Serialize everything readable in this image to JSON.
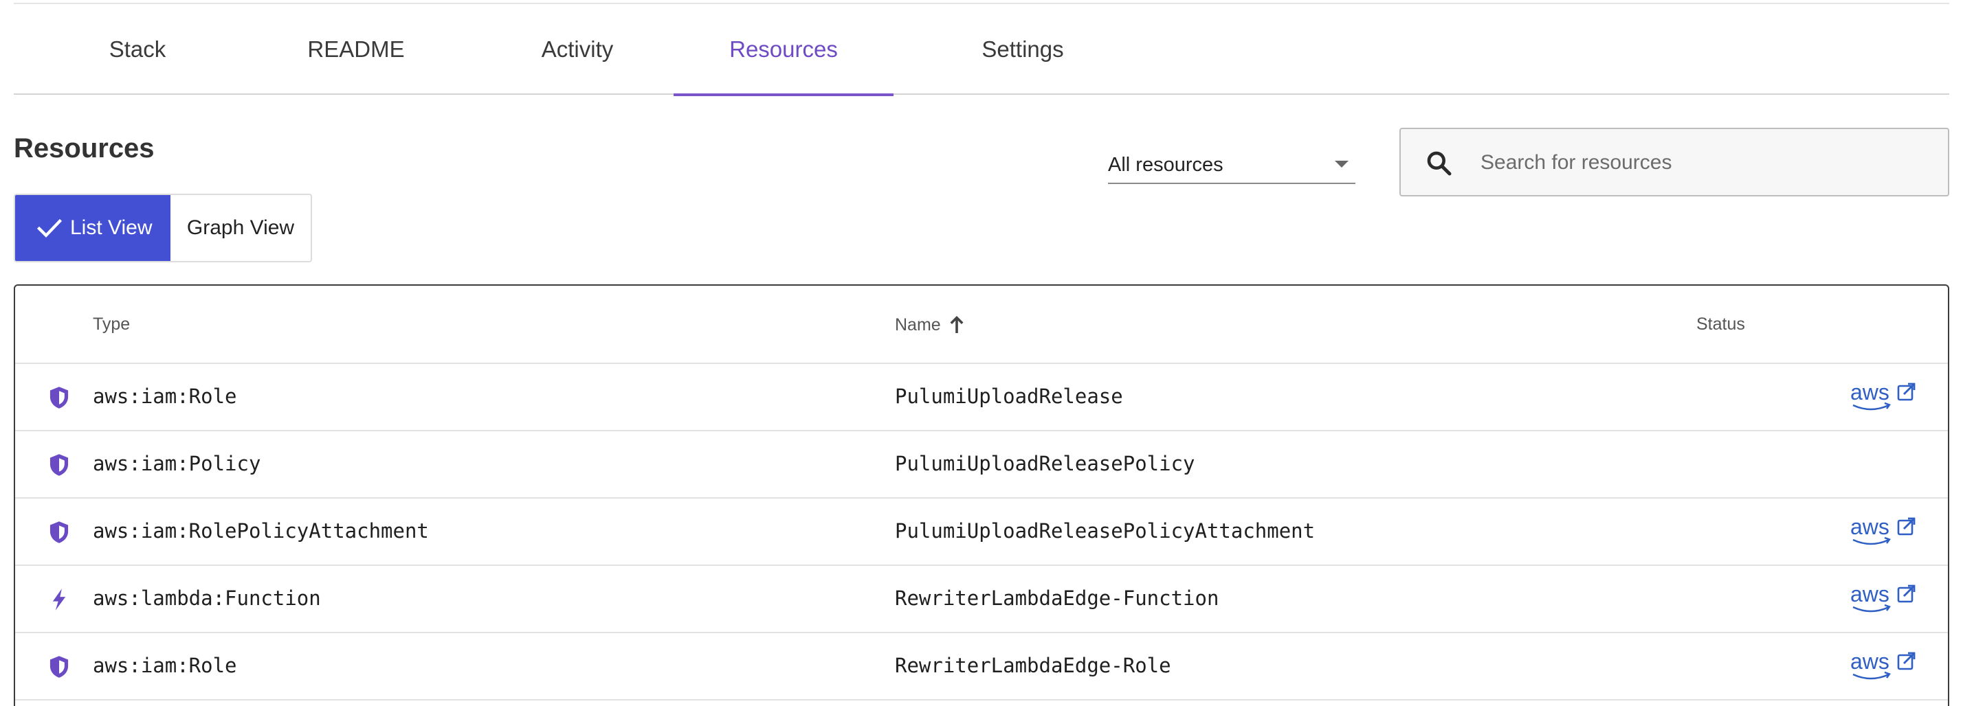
{
  "tabs": [
    {
      "label": "Stack"
    },
    {
      "label": "README"
    },
    {
      "label": "Activity"
    },
    {
      "label": "Resources",
      "active": true
    },
    {
      "label": "Settings"
    }
  ],
  "resources": {
    "title": "Resources",
    "filter": {
      "selected": "All resources"
    },
    "search": {
      "placeholder": "Search for resources",
      "value": ""
    },
    "view_toggle": {
      "list_label": "List View",
      "graph_label": "Graph View",
      "selected": "List View"
    }
  },
  "table": {
    "columns": {
      "type": "Type",
      "name": "Name",
      "status": "Status",
      "sort_column": "Name",
      "sort_direction": "ascending"
    },
    "rows": [
      {
        "icon": "shield-icon",
        "type": "aws:iam:Role",
        "name": "PulumiUploadRelease",
        "status_link": "aws-console-link-icon"
      },
      {
        "icon": "shield-icon",
        "type": "aws:iam:Policy",
        "name": "PulumiUploadReleasePolicy",
        "status_link": null
      },
      {
        "icon": "shield-icon",
        "type": "aws:iam:RolePolicyAttachment",
        "name": "PulumiUploadReleasePolicyAttachment",
        "status_link": "aws-console-link-icon"
      },
      {
        "icon": "lightning-icon",
        "type": "aws:lambda:Function",
        "name": "RewriterLambdaEdge-Function",
        "status_link": "aws-console-link-icon"
      },
      {
        "icon": "shield-icon",
        "type": "aws:iam:Role",
        "name": "RewriterLambdaEdge-Role",
        "status_link": "aws-console-link-icon"
      }
    ]
  },
  "colors": {
    "accent": "#7a55c9",
    "primary_button": "#4350d4",
    "icon_purple": "#6a4bc4",
    "aws_link": "#2f5fc4"
  }
}
